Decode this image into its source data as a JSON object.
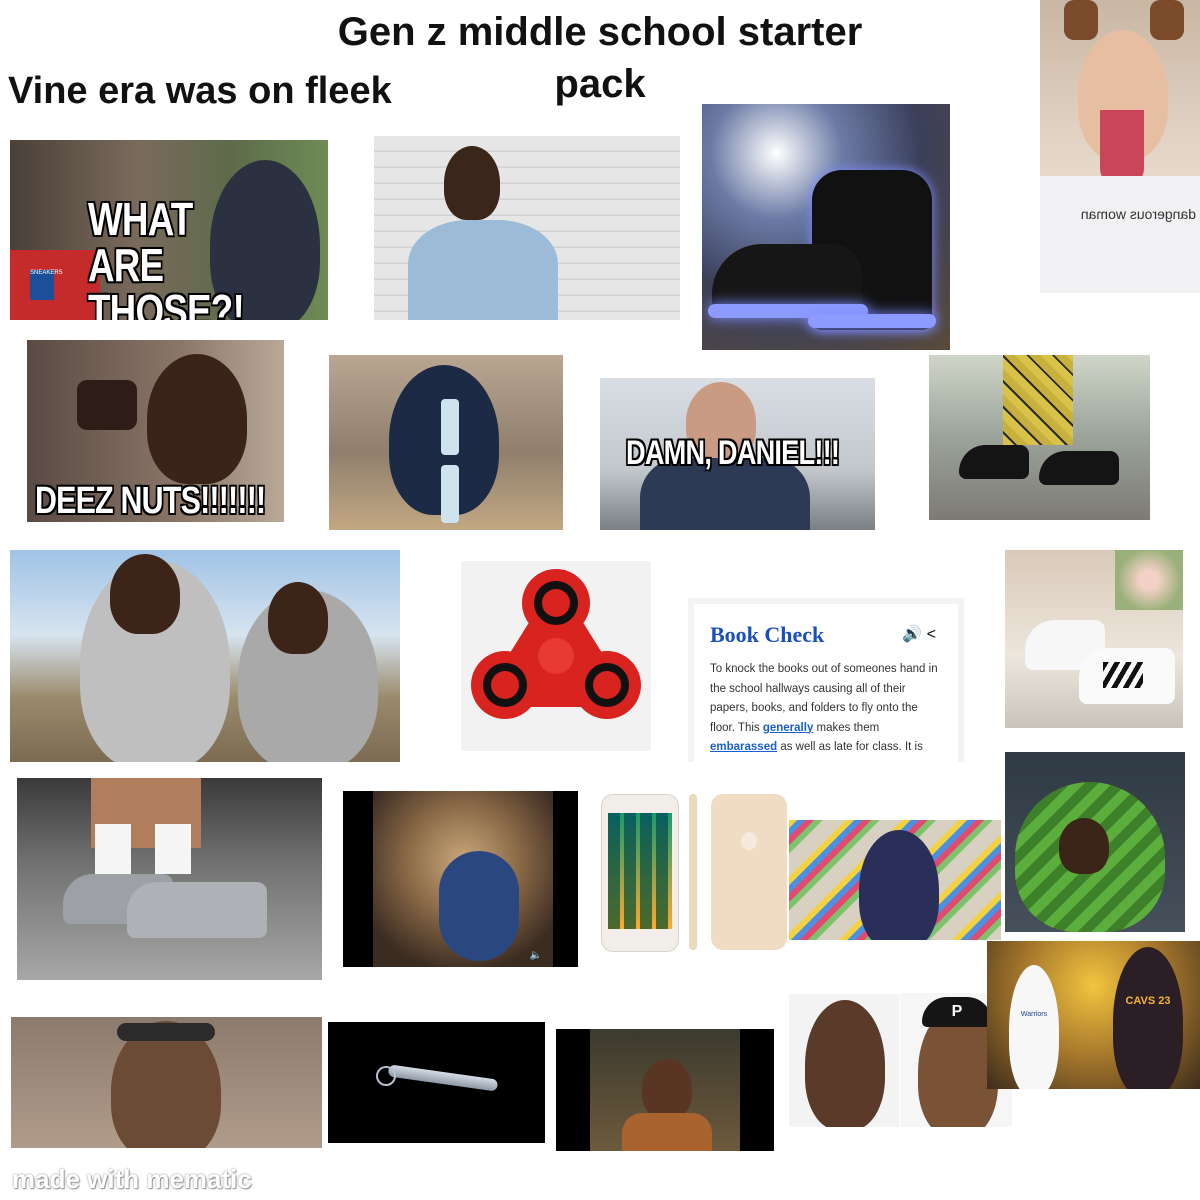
{
  "header": {
    "title": "Gen z middle school starter pack",
    "subtitle": "Vine era was on fleek"
  },
  "memes": {
    "what_are_those": "WHAT ARE THOSE?!",
    "deez_nuts": "DEEZ NUTS!!!!!!!",
    "damn_daniel": "DAMN, DANIEL!!!",
    "sneakers_logo": "SNEAKERS"
  },
  "definition": {
    "term": "Book Check",
    "text_before": "To knock the books out of someones hand in the school hallways causing all of their papers, books, and folders to fly onto the floor. This ",
    "link1": "generally",
    "text_mid": " makes them ",
    "link2": "embarassed",
    "text_after": " as well as late for class. It is"
  },
  "shirt_text": "dangerous woman",
  "jersey_left": "Warriors",
  "jersey_right": "CAVS 23",
  "cap_letter": "P",
  "footer": {
    "watermark": "made with mematic"
  },
  "colors": {
    "background": "#ffffff",
    "caption_text": "#ffffff",
    "dictionary_title": "#1a4fbf",
    "spinner_red": "#d8231f",
    "led_glow": "#7f8cff"
  }
}
